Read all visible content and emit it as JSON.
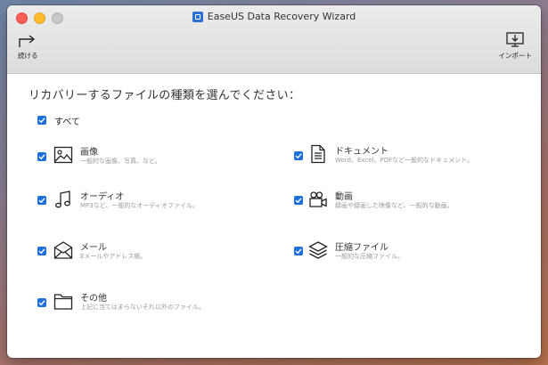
{
  "window": {
    "title": "EaseUS Data Recovery Wizard"
  },
  "toolbar": {
    "continue_label": "続ける",
    "import_label": "インポート"
  },
  "heading": "リカバリーするファイルの種類を選んでください：",
  "select_all": {
    "label": "すべて",
    "checked": true
  },
  "categories": [
    {
      "name": "画像",
      "desc": "一般的な画像、写真、など。",
      "icon": "image-icon",
      "checked": true
    },
    {
      "name": "ドキュメント",
      "desc": "Word、Excel、PDFなど一般的なドキュメント。",
      "icon": "document-icon",
      "checked": true
    },
    {
      "name": "オーディオ",
      "desc": "MP3など、一般的なオーディオファイル。",
      "icon": "music-note-icon",
      "checked": true
    },
    {
      "name": "動画",
      "desc": "録画や録画した映像など、一般的な動画。",
      "icon": "video-camera-icon",
      "checked": true
    },
    {
      "name": "メール",
      "desc": "Eメールやアドレス帳。",
      "icon": "envelope-icon",
      "checked": true
    },
    {
      "name": "圧縮ファイル",
      "desc": "一般的な圧縮ファイル。",
      "icon": "layers-icon",
      "checked": true
    },
    {
      "name": "その他",
      "desc": "上記に当てはまらないそれ以外のファイル。",
      "icon": "folder-icon",
      "checked": true
    }
  ],
  "colors": {
    "checkbox": "#1f6fdb",
    "accent": "#2c6fd6"
  }
}
